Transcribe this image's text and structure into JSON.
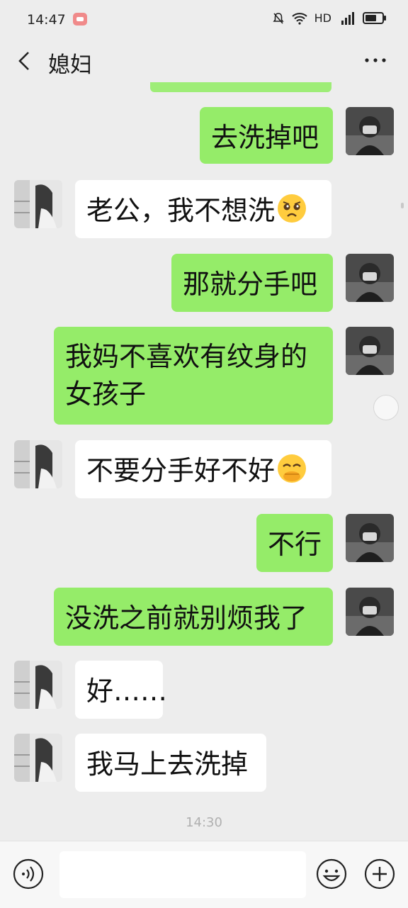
{
  "status_bar": {
    "time": "14:47",
    "network": "HD"
  },
  "header": {
    "title": "媳妇",
    "more_label": "···"
  },
  "messages": [
    {
      "from": "me",
      "text": "去洗掉吧"
    },
    {
      "from": "them",
      "text": "老公，我不想洗",
      "emoji": "pleading-face-icon"
    },
    {
      "from": "me",
      "text": "那就分手吧"
    },
    {
      "from": "me",
      "text": "我妈不喜欢有纹身的\n女孩子"
    },
    {
      "from": "them",
      "text": "不要分手好不好",
      "emoji": "hand-over-mouth-face-icon"
    },
    {
      "from": "me",
      "text": "不行"
    },
    {
      "from": "me",
      "text": "没洗之前就别烦我了"
    },
    {
      "from": "them",
      "text": "好……"
    },
    {
      "from": "them",
      "text": "我马上去洗掉"
    }
  ],
  "timestamp": "14:30",
  "composer": {
    "placeholder": ""
  },
  "colors": {
    "my_bubble": "#95ec69",
    "their_bubble": "#ffffff",
    "background": "#ededed"
  }
}
